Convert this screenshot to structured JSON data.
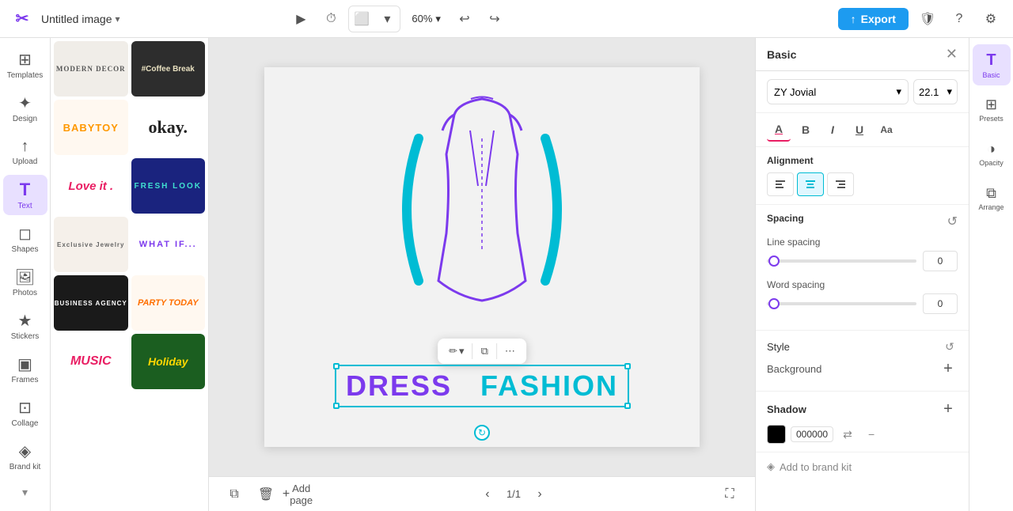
{
  "topbar": {
    "logo": "✂",
    "document_title": "Untitled image",
    "zoom_level": "60%",
    "export_label": "Export",
    "undo_icon": "↩",
    "redo_icon": "↪",
    "chevron_down": "▾"
  },
  "sidebar": {
    "items": [
      {
        "id": "templates",
        "label": "Templates",
        "icon": "⊞"
      },
      {
        "id": "design",
        "label": "Design",
        "icon": "✦"
      },
      {
        "id": "upload",
        "label": "Upload",
        "icon": "↑"
      },
      {
        "id": "text",
        "label": "Text",
        "icon": "T"
      },
      {
        "id": "shapes",
        "label": "Shapes",
        "icon": "◻"
      },
      {
        "id": "photos",
        "label": "Photos",
        "icon": "🖼"
      },
      {
        "id": "stickers",
        "label": "Stickers",
        "icon": "★"
      },
      {
        "id": "frames",
        "label": "Frames",
        "icon": "▣"
      },
      {
        "id": "collage",
        "label": "Collage",
        "icon": "⊡"
      },
      {
        "id": "brand",
        "label": "Brand kit",
        "icon": "◈"
      }
    ],
    "active": "text"
  },
  "templates": {
    "cards": [
      {
        "id": "modern-decor",
        "label": "MODERN DECOR",
        "style": "tc-modern"
      },
      {
        "id": "coffee-break",
        "label": "#Coffee Break",
        "style": "tc-coffee"
      },
      {
        "id": "babytoy",
        "label": "BABYTOY",
        "style": "tc-baby"
      },
      {
        "id": "okay",
        "label": "okay.",
        "style": "tc-okay"
      },
      {
        "id": "love-it",
        "label": "Love it .",
        "style": "tc-loveit"
      },
      {
        "id": "fresh-look",
        "label": "FRESH LOOK",
        "style": "tc-freshlook"
      },
      {
        "id": "exclusive-jewelry",
        "label": "Exclusive Jewelry",
        "style": "tc-exclusive"
      },
      {
        "id": "what-if",
        "label": "WHAT IF...",
        "style": "tc-whatif"
      },
      {
        "id": "business-agency",
        "label": "BUSINESS AGENCY",
        "style": "tc-business"
      },
      {
        "id": "party-today",
        "label": "PARTY TODAY",
        "style": "tc-party"
      },
      {
        "id": "music",
        "label": "MUSIC",
        "style": "tc-music"
      },
      {
        "id": "holiday",
        "label": "Holiday",
        "style": "tc-holiday"
      }
    ]
  },
  "canvas": {
    "text_word1": "DRESS",
    "text_word2": "FASHION",
    "page_indicator": "1/1",
    "add_page_label": "Add page"
  },
  "floating_toolbar": {
    "edit_label": "✏",
    "copy_label": "⧉",
    "more_label": "⋯"
  },
  "right_panel": {
    "title": "Basic",
    "close_icon": "✕",
    "font_family": "ZY Jovial",
    "font_size": "22.1",
    "format_buttons": [
      {
        "id": "color",
        "label": "A",
        "icon": "A"
      },
      {
        "id": "bold",
        "label": "B"
      },
      {
        "id": "italic",
        "label": "I"
      },
      {
        "id": "underline",
        "label": "U"
      },
      {
        "id": "case",
        "label": "Aa"
      }
    ],
    "alignment": {
      "title": "Alignment",
      "options": [
        "left",
        "center",
        "right"
      ],
      "active": "center"
    },
    "spacing": {
      "title": "Spacing",
      "line_spacing_label": "Line spacing",
      "line_spacing_value": "0",
      "word_spacing_label": "Word spacing",
      "word_spacing_value": "0"
    },
    "style": {
      "title": "Style",
      "background_label": "Background",
      "reset_icon": "↺"
    },
    "shadow": {
      "title": "Shadow",
      "color": "#000000",
      "color_label": "000000",
      "add_icon": "+",
      "transfer_icon": "⇄",
      "minus_icon": "−"
    },
    "brand_kit": {
      "label": "Add to brand kit",
      "icon": "◈"
    }
  },
  "far_right": {
    "items": [
      {
        "id": "basic",
        "label": "Basic",
        "icon": "T",
        "active": true
      },
      {
        "id": "presets",
        "label": "Presets",
        "icon": "⊞"
      },
      {
        "id": "opacity",
        "label": "Opacity",
        "icon": "◑"
      },
      {
        "id": "arrange",
        "label": "Arrange",
        "icon": "⧉"
      }
    ]
  }
}
